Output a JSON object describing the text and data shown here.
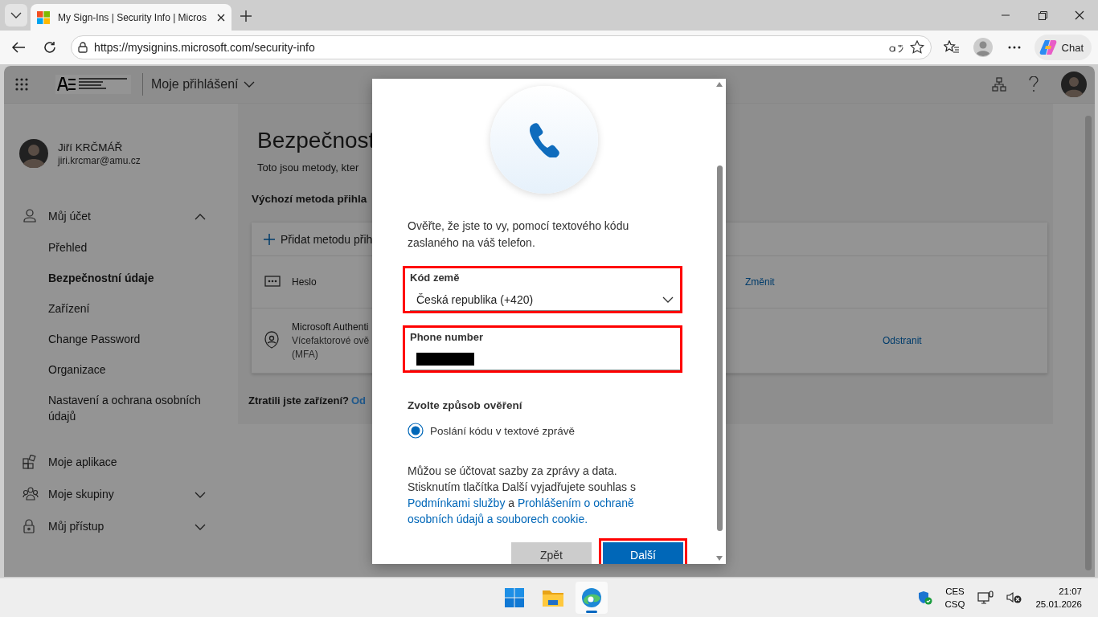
{
  "browser": {
    "tab_title": "My Sign-Ins | Security Info | Micros",
    "url": "https://mysignins.microsoft.com/security-info",
    "chat_label": "Chat"
  },
  "header": {
    "app_title": "Moje přihlášení"
  },
  "user": {
    "name": "Jiří KRČMÁŘ",
    "email": "jiri.krcmar@amu.cz"
  },
  "nav": [
    {
      "kind": "expandable",
      "label": "Můj účet",
      "expanded": true,
      "children": [
        {
          "label": "Přehled",
          "selected": false
        },
        {
          "label": "Bezpečnostní údaje",
          "selected": true
        },
        {
          "label": "Zařízení",
          "selected": false
        },
        {
          "label": "Change Password",
          "selected": false
        },
        {
          "label": "Organizace",
          "selected": false
        },
        {
          "label": "Nastavení a ochrana osobních údajů",
          "selected": false
        }
      ]
    },
    {
      "kind": "link",
      "label": "Moje aplikace"
    },
    {
      "kind": "expandable",
      "label": "Moje skupiny",
      "expanded": false
    },
    {
      "kind": "expandable",
      "label": "Můj přístup",
      "expanded": false
    }
  ],
  "main": {
    "title": "Bezpečnost",
    "subtitle": "Toto jsou metody, kter",
    "default_method_label": "Výchozí metoda přihla",
    "add_method": "Přidat metodu přih",
    "methods": [
      {
        "kind": "password",
        "name": "Heslo",
        "action": "Změnit"
      },
      {
        "kind": "authenticator",
        "name": "Microsoft Authenti",
        "detail": "Vícefaktorové ově",
        "detail_2": "(MFA)",
        "action": "Odstranit"
      }
    ],
    "lost_device": "Ztratili jste zařízení?",
    "lost_device_link": "Od"
  },
  "dialog": {
    "intro": "Ověřte, že jste to vy, pomocí textového kódu zaslaného na váš telefon.",
    "fields": [
      {
        "kind": "dropdown",
        "label": "Kód země",
        "value": "Česká republika (+420)",
        "highlighted": true
      },
      {
        "kind": "text",
        "label": "Phone number",
        "redacted": true,
        "highlighted": true
      }
    ],
    "method_heading": "Zvolte způsob ověření",
    "options": [
      {
        "label": "Poslání kódu v textové zprávě",
        "selected": true
      }
    ],
    "notice_lines": [
      "Můžou se účtovat sazby za zprávy a data.",
      "Stisknutím tlačítka Další vyjadřujete souhlas s"
    ],
    "terms_link": "Podmínkami služby",
    "conjunction": "a",
    "privacy_link_lines": [
      "Prohlášením o ochraně",
      "osobních údajů a souborech cookie."
    ],
    "buttons": [
      {
        "kind": "secondary",
        "label": "Zpět",
        "highlighted": false
      },
      {
        "kind": "primary",
        "label": "Další",
        "highlighted": true
      }
    ]
  },
  "taskbar": {
    "apps": [
      {
        "kind": "start",
        "selected": false
      },
      {
        "kind": "files",
        "selected": false
      },
      {
        "kind": "browser",
        "selected": true
      }
    ],
    "language": [
      "CES",
      "CSQ"
    ],
    "time": "21:07",
    "date": "25.01.2026"
  }
}
